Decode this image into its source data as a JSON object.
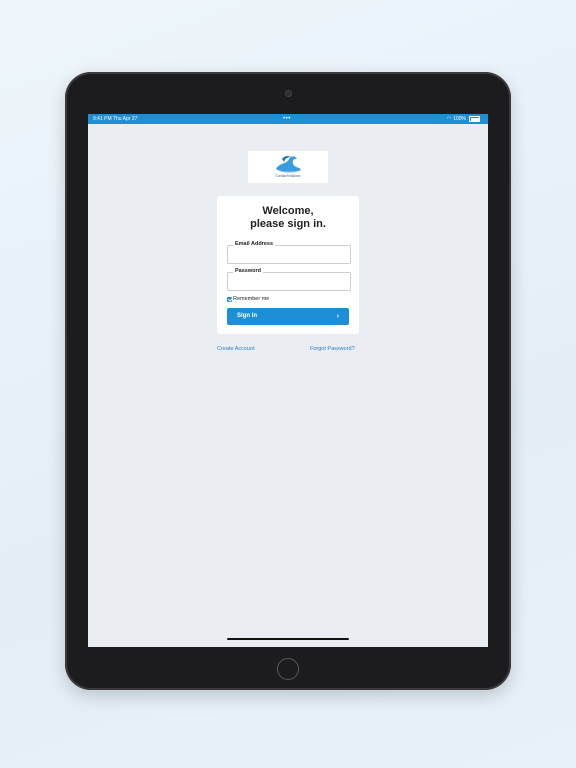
{
  "status_bar": {
    "time_date": "9:41 PM  Thu Apr 27",
    "dots": "•••",
    "battery_text": "100%"
  },
  "logo": {
    "brand_text": "CardiacSolutions"
  },
  "login": {
    "welcome_line1": "Welcome,",
    "welcome_line2": "please sign in.",
    "email_label": "Email Address",
    "email_value": "",
    "password_label": "Password",
    "password_value": "",
    "remember_label": "Remember me",
    "remember_checked": true,
    "signin_label": "Sign In",
    "signin_chevron": "›"
  },
  "links": {
    "create_account": "Create Account",
    "forgot_password": "Forgot Password?"
  },
  "colors": {
    "accent": "#1d8fd6",
    "screen_bg": "#eaedf1",
    "link": "#2a7fc4"
  }
}
